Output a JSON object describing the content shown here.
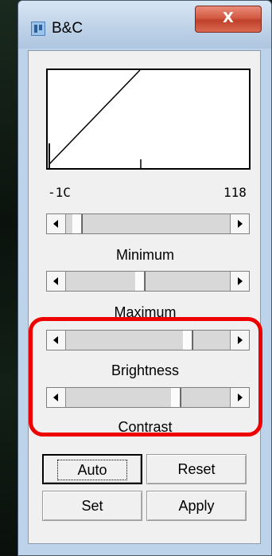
{
  "window": {
    "title": "B&C",
    "close_glyph": "X"
  },
  "histogram": {
    "range_min": "-1C",
    "range_max": "118"
  },
  "sliders": [
    {
      "label": "Minimum",
      "value": 0.04
    },
    {
      "label": "Maximum",
      "value": 0.45
    },
    {
      "label": "Brightness",
      "value": 0.76
    },
    {
      "label": "Contrast",
      "value": 0.68
    }
  ],
  "buttons": {
    "auto": "Auto",
    "reset": "Reset",
    "set": "Set",
    "apply": "Apply"
  },
  "icons": [
    "imagej-app-icon",
    "close-icon",
    "left-arrow-icon",
    "right-arrow-icon"
  ],
  "colors": {
    "highlight": "#ee0000",
    "title_bar": "#bcd3ea",
    "close_button": "#c0402a"
  }
}
